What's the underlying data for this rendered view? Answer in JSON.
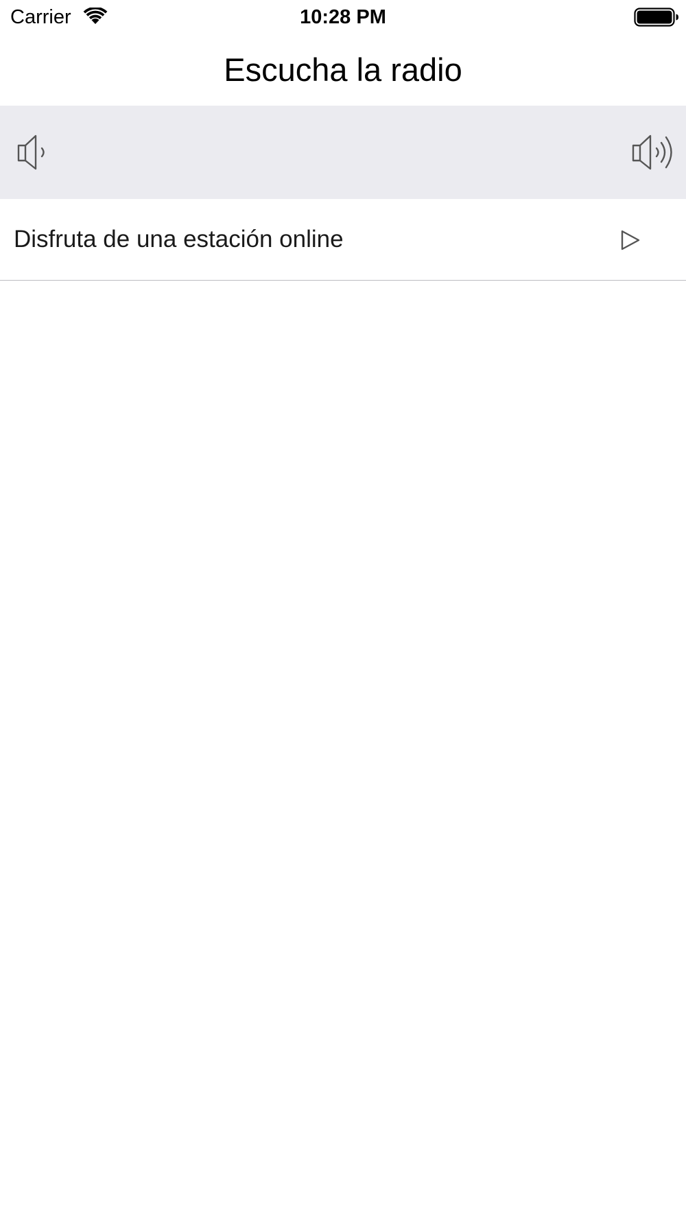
{
  "status_bar": {
    "carrier": "Carrier",
    "time": "10:28 PM",
    "wifi_icon": "wifi-icon",
    "battery_icon": "battery-icon"
  },
  "nav": {
    "title": "Escucha la radio"
  },
  "volume": {
    "min_icon": "speaker-low-icon",
    "max_icon": "speaker-high-icon"
  },
  "list": {
    "items": [
      {
        "label": "Disfruta de una estación online",
        "icon": "play-icon"
      }
    ]
  },
  "colors": {
    "volume_bar_bg": "#ebebf0",
    "separator": "#bcbcc0",
    "icon_stroke": "#555555"
  }
}
